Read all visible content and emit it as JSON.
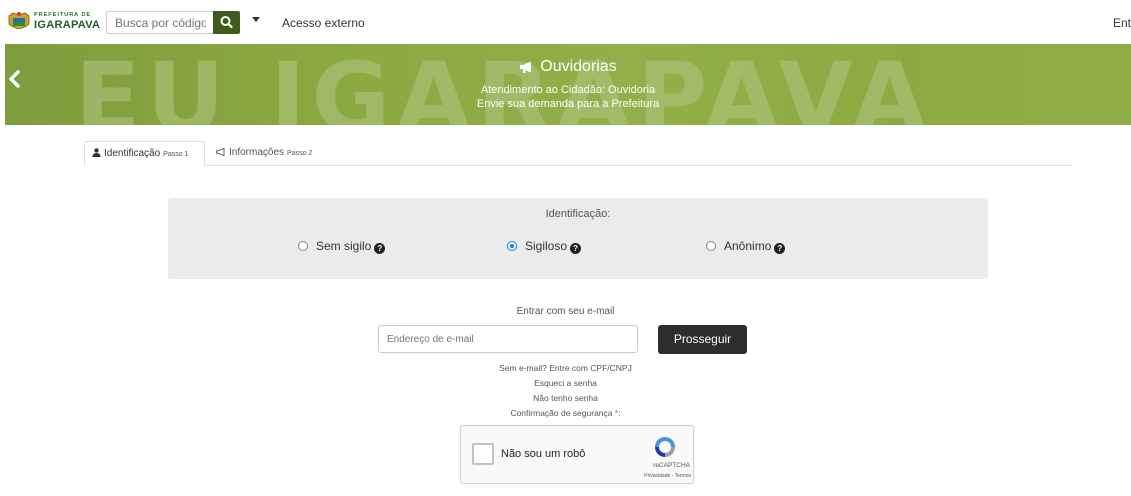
{
  "header": {
    "logo_line1": "PREFEITURA DE",
    "logo_line2": "IGARAPAVA",
    "search_placeholder": "Busca por código",
    "external_access": "Acesso externo",
    "login": "Entr"
  },
  "banner": {
    "title": "Ouvidorias",
    "subtitle1": "Atendimento ao Cidadão: Ouvidoria",
    "subtitle2": "Envie sua demanda para a Prefeitura",
    "background_text": "EU IGARAPAVA"
  },
  "tabs": [
    {
      "label": "Identificação",
      "step": "Passo 1",
      "icon": "user-icon",
      "active": true
    },
    {
      "label": "Informações",
      "step": "Passo 2",
      "icon": "megaphone-icon",
      "active": false
    }
  ],
  "identification": {
    "title": "Identificação:",
    "options": [
      {
        "label": "Sem sigilo",
        "selected": false
      },
      {
        "label": "Sigiloso",
        "selected": true
      },
      {
        "label": "Anônimo",
        "selected": false
      }
    ]
  },
  "login": {
    "title": "Entrar com seu e-mail",
    "email_placeholder": "Endereço de e-mail",
    "submit": "Prosseguir",
    "cpf_link": "Sem e-mail? Entre com CPF/CNPJ",
    "forgot_link": "Esqueci a senha",
    "no_password_link": "Não tenho senha",
    "security_label": "Confirmação de segurança",
    "required_mark": "*",
    "security_suffix": ":"
  },
  "captcha": {
    "label": "Não sou um robô",
    "brand": "reCAPTCHA",
    "terms": "Privacidade - Termos"
  },
  "colors": {
    "search_button": "#3f5a1a",
    "banner_green": "#9cb84f",
    "primary_button": "#2d2d2d",
    "radio_selected": "#1a73e8"
  }
}
